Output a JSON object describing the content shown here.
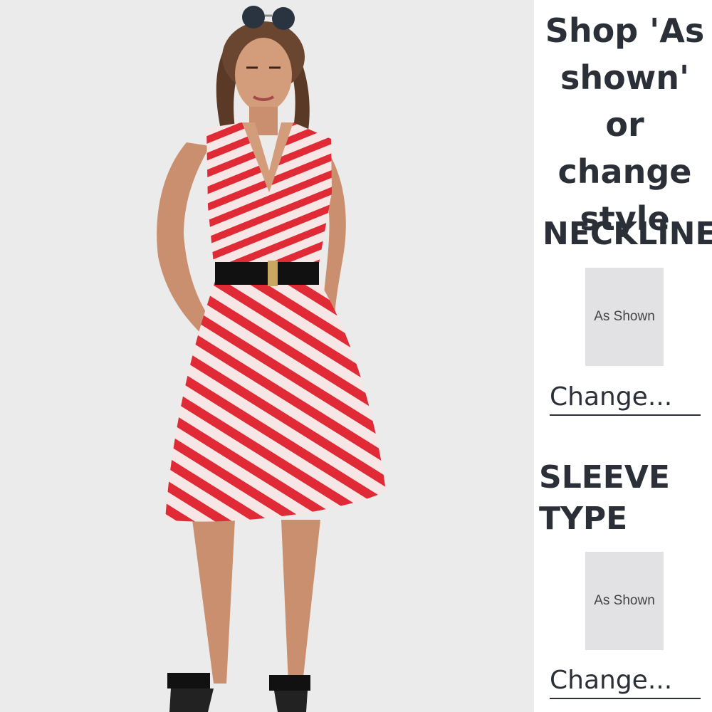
{
  "panel": {
    "headline": "Shop 'As shown' or change style",
    "sections": [
      {
        "title": "NECKLINE",
        "option_label": "As Shown",
        "change_label": "Change..."
      },
      {
        "title": "SLEEVE TYPE",
        "option_label": "As Shown",
        "change_label": "Change..."
      }
    ]
  },
  "colors": {
    "photo_background": "#ebebeb",
    "dress_stripe": "#e02a35",
    "dress_base": "#f6e7e6",
    "belt": "#111111",
    "text": "#2b2f38",
    "tile": "#e2e2e4"
  }
}
